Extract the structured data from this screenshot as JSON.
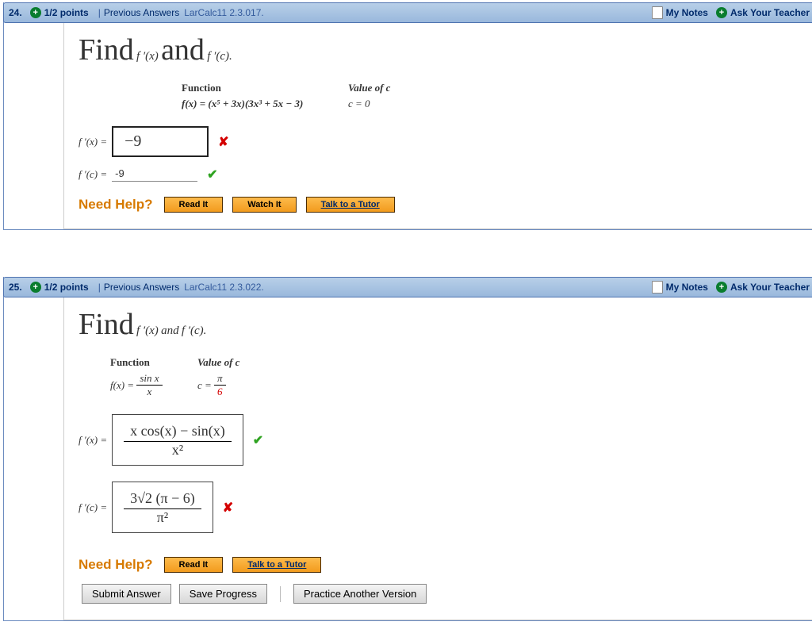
{
  "q24": {
    "number": "24.",
    "points": "1/2 points",
    "prev": "Previous Answers",
    "ref": "LarCalc11 2.3.017.",
    "my_notes": "My Notes",
    "ask": "Ask Your Teacher",
    "find": "Find",
    "and": "and",
    "fpx": "f ′(x)",
    "fpc": "f ′(c).",
    "func_head": "Function",
    "valc_head": "Value of c",
    "func_expr": "f(x) = (x⁵ + 3x)(3x³ + 5x − 3)",
    "cval": "c = 0",
    "row1_lhs": "f ′(x) =",
    "row1_ans": "−9",
    "row2_lhs": "f ′(c) =",
    "row2_ans": "-9",
    "need_help": "Need Help?",
    "read": "Read It",
    "watch": "Watch It",
    "tutor": "Talk to a Tutor"
  },
  "q25": {
    "number": "25.",
    "points": "1/2 points",
    "prev": "Previous Answers",
    "ref": "LarCalc11 2.3.022.",
    "my_notes": "My Notes",
    "ask": "Ask Your Teacher",
    "find": "Find",
    "fpx": "f ′(x)",
    "conn": "and",
    "fpc": "f ′(c).",
    "func_head": "Function",
    "valc_head": "Value of c",
    "func_lhs": "f(x) =",
    "func_num": "sin x",
    "func_den": "x",
    "c_lhs": "c =",
    "c_num": "π",
    "c_den": "6",
    "row1_lhs": "f ′(x) =",
    "row1_num": "x cos(x) − sin(x)",
    "row1_den": "x²",
    "row2_lhs": "f ′(c) =",
    "row2_num": "3√2 (π − 6)",
    "row2_den": "π²",
    "need_help": "Need Help?",
    "read": "Read It",
    "tutor": "Talk to a Tutor",
    "submit": "Submit Answer",
    "save": "Save Progress",
    "practice": "Practice Another Version"
  }
}
